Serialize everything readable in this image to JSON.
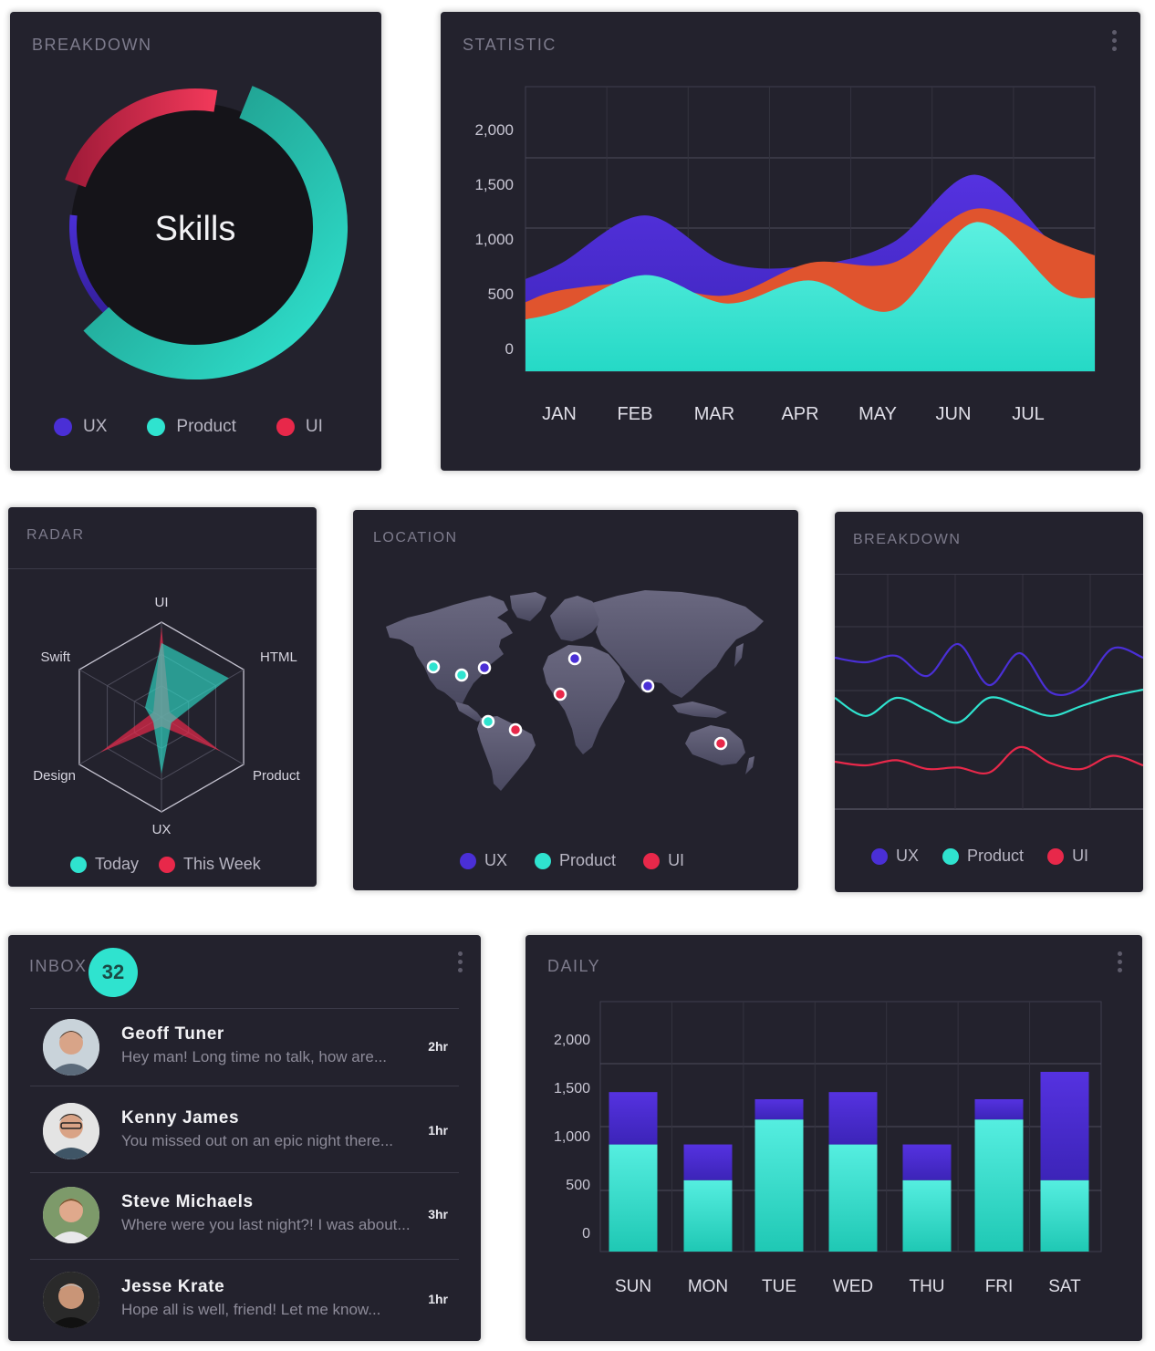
{
  "colors": {
    "ux": "#4a2fd6",
    "product": "#2fe3cf",
    "ui": "#e8284a",
    "orange": "#e0542e",
    "card_bg": "#23222d"
  },
  "skills_card": {
    "title": "BREAKDOWN",
    "center_label": "Skills",
    "legend": [
      {
        "label": "UX",
        "color": "#4a2fd6"
      },
      {
        "label": "Product",
        "color": "#2fe3cf"
      },
      {
        "label": "UI",
        "color": "#e8284a"
      }
    ]
  },
  "statistic_card": {
    "title": "STATISTIC",
    "menu_icon": "more-vertical-icon"
  },
  "radar_card": {
    "title": "RADAR",
    "axes": [
      "UI",
      "HTML",
      "Product",
      "UX",
      "Design",
      "Swift"
    ],
    "legend": [
      {
        "label": "Today",
        "color": "#2fe3cf"
      },
      {
        "label": "This Week",
        "color": "#e8284a"
      }
    ]
  },
  "location_card": {
    "title": "LOCATION",
    "legend": [
      {
        "label": "UX",
        "color": "#4a2fd6"
      },
      {
        "label": "Product",
        "color": "#2fe3cf"
      },
      {
        "label": "UI",
        "color": "#e8284a"
      }
    ]
  },
  "breakdown_lines_card": {
    "title": "BREAKDOWN",
    "legend": [
      {
        "label": "UX",
        "color": "#4a2fd6"
      },
      {
        "label": "Product",
        "color": "#2fe3cf"
      },
      {
        "label": "UI",
        "color": "#e8284a"
      }
    ]
  },
  "inbox_card": {
    "title": "INBOX",
    "badge": "32",
    "messages": [
      {
        "name": "Geoff Tuner",
        "preview": "Hey man! Long time no talk, how are...",
        "time": "2hr"
      },
      {
        "name": "Kenny James",
        "preview": "You missed out on an epic night there...",
        "time": "1hr"
      },
      {
        "name": "Steve Michaels",
        "preview": "Where were you last night?! I was about...",
        "time": "3hr"
      },
      {
        "name": "Jesse Krate",
        "preview": "Hope all is well, friend! Let me know...",
        "time": "1hr"
      }
    ]
  },
  "daily_card": {
    "title": "DAILY"
  },
  "chart_data": [
    {
      "id": "skills",
      "type": "pie",
      "title": "Skills",
      "categories": [
        "UX",
        "Product",
        "UI"
      ],
      "values": [
        21,
        57,
        22
      ]
    },
    {
      "id": "statistic",
      "type": "area",
      "title": "STATISTIC",
      "categories": [
        "JAN",
        "FEB",
        "MAR",
        "APR",
        "MAY",
        "JUN",
        "JUL"
      ],
      "yticks": [
        "0",
        "500",
        "1,000",
        "1,500",
        "2,000"
      ],
      "ylim": [
        0,
        2100
      ],
      "grid": true,
      "series": [
        {
          "name": "UX",
          "color": "#4a2fd6",
          "values": [
            800,
            1150,
            800,
            780,
            950,
            1450,
            900
          ]
        },
        {
          "name": "UI",
          "color": "#e0542e",
          "values": [
            600,
            650,
            560,
            800,
            800,
            1200,
            950
          ]
        },
        {
          "name": "Product",
          "color": "#2fe3cf",
          "values": [
            450,
            710,
            500,
            670,
            450,
            1100,
            600
          ]
        }
      ]
    },
    {
      "id": "radar",
      "type": "radar",
      "title": "RADAR",
      "categories": [
        "UI",
        "HTML",
        "Product",
        "UX",
        "Design",
        "Swift"
      ],
      "series": [
        {
          "name": "Today",
          "color": "#2fe3cf",
          "values": [
            0.78,
            0.82,
            0.12,
            0.6,
            0.1,
            0.2
          ]
        },
        {
          "name": "This Week",
          "color": "#e8284a",
          "values": [
            0.95,
            0.1,
            0.72,
            0.1,
            0.75,
            0.1
          ]
        }
      ]
    },
    {
      "id": "breakdown_lines",
      "type": "line",
      "title": "BREAKDOWN",
      "series": [
        {
          "name": "UX",
          "color": "#4a2fd6",
          "values": [
            60,
            55,
            62,
            40,
            75,
            30,
            65,
            22,
            28,
            70,
            60
          ]
        },
        {
          "name": "Product",
          "color": "#2fe3cf",
          "values": [
            40,
            18,
            40,
            25,
            10,
            40,
            30,
            18,
            30,
            42,
            50
          ]
        },
        {
          "name": "UI",
          "color": "#e8284a",
          "values": [
            20,
            15,
            22,
            10,
            12,
            5,
            40,
            18,
            10,
            28,
            15
          ]
        }
      ]
    },
    {
      "id": "daily",
      "type": "bar",
      "title": "DAILY",
      "categories": [
        "SUN",
        "MON",
        "TUE",
        "WED",
        "THU",
        "FRI",
        "SAT"
      ],
      "yticks": [
        "0",
        "500",
        "1,000",
        "1,500",
        "2,000"
      ],
      "ylim": [
        0,
        2100
      ],
      "stacked": true,
      "grid": true,
      "series": [
        {
          "name": "Product",
          "color": "#2fe3cf",
          "values": [
            900,
            600,
            1110,
            900,
            600,
            1110,
            600
          ]
        },
        {
          "name": "UX",
          "color": "#4a2fd6",
          "values": [
            440,
            300,
            170,
            440,
            300,
            170,
            910
          ]
        }
      ]
    }
  ]
}
